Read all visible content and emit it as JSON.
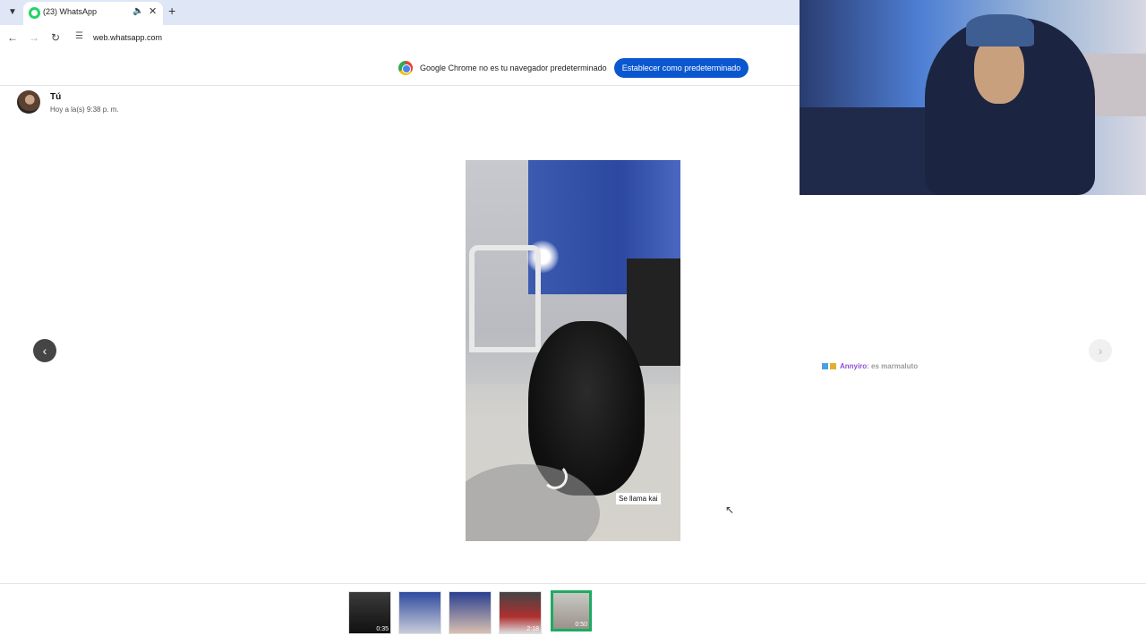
{
  "browser": {
    "tab_title": "(23) WhatsApp",
    "url": "web.whatsapp.com",
    "infobar_message": "Google Chrome no es tu navegador predeterminado",
    "infobar_button": "Establecer como predeterminado"
  },
  "viewer": {
    "sender": "Tú",
    "timestamp": "Hoy a la(s) 9:38 p. m.",
    "media_caption": "Se llama kai",
    "thumbnails": [
      {
        "duration": "0:35"
      },
      {
        "duration": ""
      },
      {
        "duration": ""
      },
      {
        "duration": "2:18"
      },
      {
        "duration": "0:50"
      }
    ]
  },
  "stream_chat": {
    "username": "Annyiro",
    "message": ": es marmaluto"
  },
  "colors": {
    "whatsapp_green": "#1daa61",
    "chrome_blue": "#0b57d0"
  }
}
